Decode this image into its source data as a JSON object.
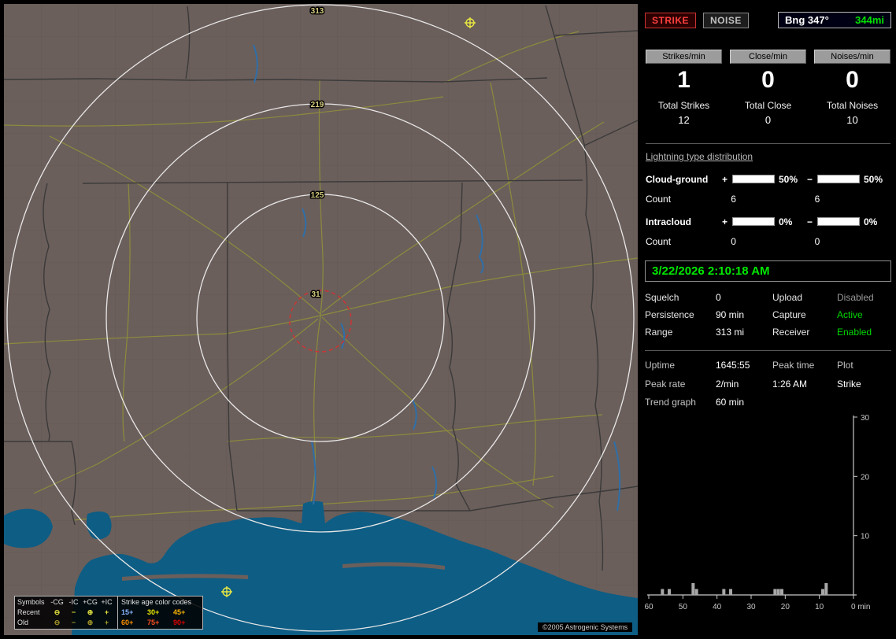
{
  "colors": {
    "accent_green": "#00e000",
    "accent_red": "#e80000",
    "minus_blue": "#84b8ec",
    "map_land": "#6b5f5b",
    "water": "#0e5d84"
  },
  "map": {
    "range_labels": {
      "r313": "313",
      "r219": "219",
      "r125": "125",
      "r31": "31"
    },
    "legend": {
      "symbols_header": "Symbols",
      "columns": [
        "-CG",
        "-IC",
        "+CG",
        "+IC"
      ],
      "recent_label": "Recent",
      "old_label": "Old",
      "recent_symbols": [
        "⊖",
        "−",
        "⊕",
        "+"
      ],
      "old_symbols": [
        "⊖",
        "−",
        "⊕",
        "+"
      ],
      "recent_color": "#e8e840",
      "old_color": "#a89a28",
      "age_header": "Strike age color codes",
      "age_recent": [
        {
          "text": "15+",
          "color": "#8ab4ff"
        },
        {
          "text": "30+",
          "color": "#e8e800"
        },
        {
          "text": "45+",
          "color": "#ffb400"
        }
      ],
      "age_old": [
        {
          "text": "60+",
          "color": "#ff9000"
        },
        {
          "text": "75+",
          "color": "#ff5020"
        },
        {
          "text": "90+",
          "color": "#e00000"
        }
      ]
    },
    "copyright": "©2005 Astrogenic Systems"
  },
  "sidebar": {
    "strike_button": "STRIKE",
    "noise_button": "NOISE",
    "bearing": {
      "label": "Bng 347°",
      "distance": "344mi"
    },
    "rates": [
      {
        "header": "Strikes/min",
        "value": "1",
        "total_label": "Total Strikes",
        "total": "12"
      },
      {
        "header": "Close/min",
        "value": "0",
        "total_label": "Total Close",
        "total": "0"
      },
      {
        "header": "Noises/min",
        "value": "0",
        "total_label": "Total Noises",
        "total": "10"
      }
    ],
    "distribution": {
      "title": "Lightning type distribution",
      "plus_sign": "+",
      "minus_sign": "−",
      "count_label": "Count",
      "rows": [
        {
          "label": "Cloud-ground",
          "plus_fill": "50",
          "plus_pct": "50%",
          "minus_fill": "50",
          "minus_pct": "50%",
          "plus_count": "6",
          "minus_count": "6"
        },
        {
          "label": "Intracloud",
          "plus_fill": "0",
          "plus_pct": "0%",
          "minus_fill": "0",
          "minus_pct": "0%",
          "plus_count": "0",
          "minus_count": "0"
        }
      ]
    },
    "datetime": "3/22/2026 2:10:18 AM",
    "settings": [
      {
        "label": "Squelch",
        "value": "0",
        "label2": "Upload",
        "value2": "Disabled",
        "value2_color": "#9a9a9a"
      },
      {
        "label": "Persistence",
        "value": "90 min",
        "label2": "Capture",
        "value2": "Active",
        "value2_color": "#00d800"
      },
      {
        "label": "Range",
        "value": "313 mi",
        "label2": "Receiver",
        "value2": "Enabled",
        "value2_color": "#00d800"
      }
    ],
    "status": {
      "uptime_label": "Uptime",
      "uptime_value": "1645:55",
      "peak_time_label": "Peak time",
      "peak_time_value": "1:26 AM",
      "plot_label": "Plot",
      "plot_value": "Strike",
      "peak_rate_label": "Peak rate",
      "peak_rate_value": "2/min",
      "trend_label": "Trend graph",
      "trend_value": "60 min"
    }
  },
  "chart_data": {
    "type": "bar",
    "title": "Trend graph (strikes per minute, last 60 min)",
    "xlabel": "min",
    "ylabel": "",
    "xlim_minutes_ago": [
      60,
      0
    ],
    "ylim": [
      0,
      30
    ],
    "x_ticks": [
      {
        "min": 60,
        "label": "60"
      },
      {
        "min": 50,
        "label": "50"
      },
      {
        "min": 40,
        "label": "40"
      },
      {
        "min": 30,
        "label": "30"
      },
      {
        "min": 20,
        "label": "20"
      },
      {
        "min": 10,
        "label": "10"
      },
      {
        "min": 0,
        "label": "0 min"
      }
    ],
    "y_ticks": [
      {
        "value": 30,
        "label": "30"
      },
      {
        "value": 20,
        "label": "20"
      },
      {
        "value": 10,
        "label": "10"
      }
    ],
    "bars": [
      {
        "minutes_ago": 56,
        "count": 1
      },
      {
        "minutes_ago": 54,
        "count": 1
      },
      {
        "minutes_ago": 47,
        "count": 2
      },
      {
        "minutes_ago": 46,
        "count": 1
      },
      {
        "minutes_ago": 38,
        "count": 1
      },
      {
        "minutes_ago": 36,
        "count": 1
      },
      {
        "minutes_ago": 23,
        "count": 1
      },
      {
        "minutes_ago": 22,
        "count": 1
      },
      {
        "minutes_ago": 21,
        "count": 1
      },
      {
        "minutes_ago": 9,
        "count": 1
      },
      {
        "minutes_ago": 8,
        "count": 2
      }
    ],
    "bar_color": "#a8a8a8",
    "axis_color": "#c8c8c8",
    "legend_position": "none",
    "grid": false
  }
}
